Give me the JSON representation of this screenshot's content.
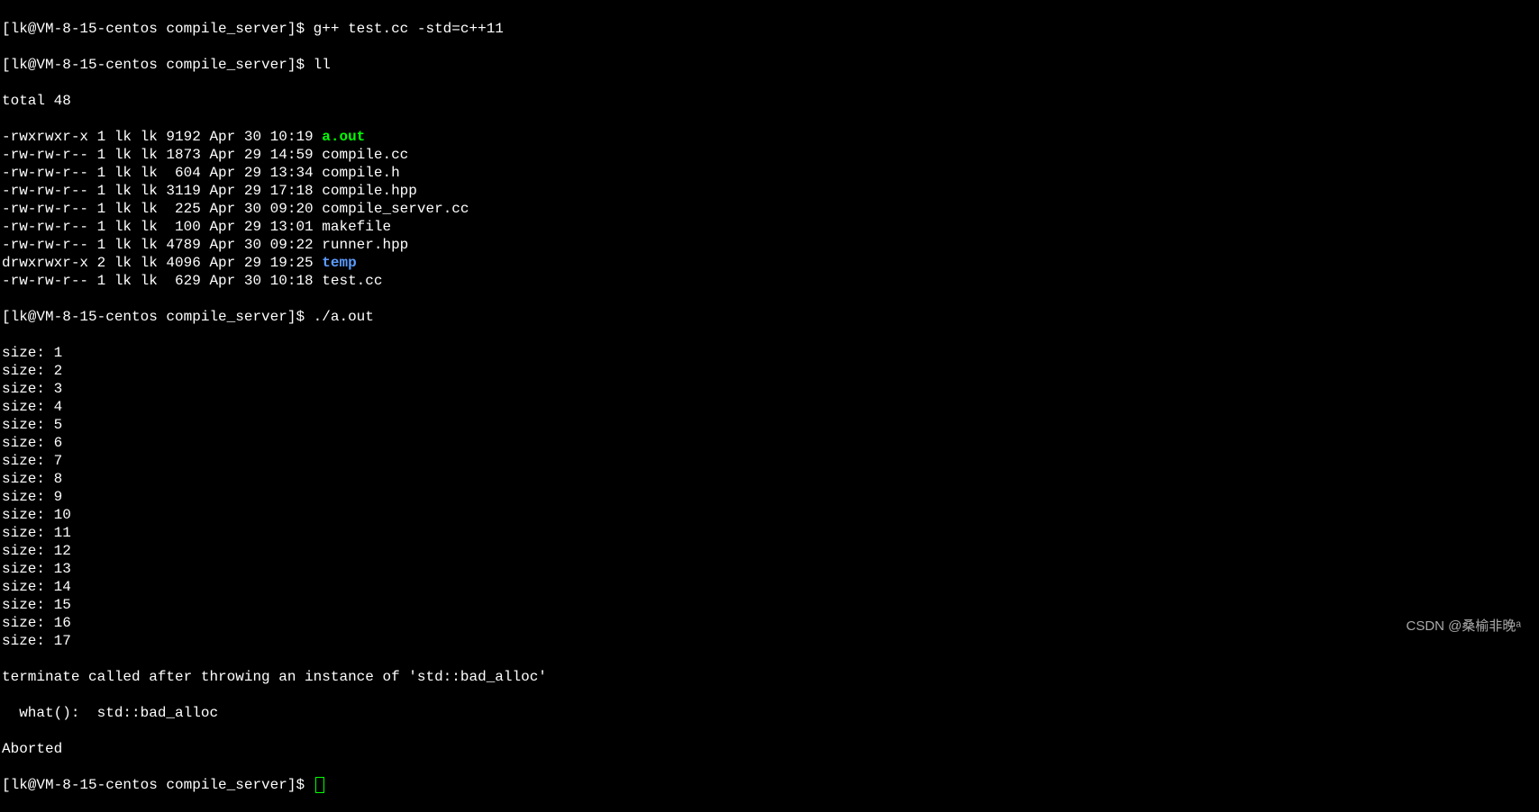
{
  "prompt": "[lk@VM-8-15-centos compile_server]$ ",
  "commands": {
    "compile": "g++ test.cc -std=c++11",
    "list": "ll",
    "run": "./a.out"
  },
  "listing": {
    "total": "total 48",
    "files": [
      {
        "perm": "-rwxrwxr-x",
        "links": "1",
        "owner": "lk",
        "group": "lk",
        "size": "9192",
        "date": "Apr 30 10:19",
        "name": "a.out",
        "type": "exec"
      },
      {
        "perm": "-rw-rw-r--",
        "links": "1",
        "owner": "lk",
        "group": "lk",
        "size": "1873",
        "date": "Apr 29 14:59",
        "name": "compile.cc",
        "type": "file"
      },
      {
        "perm": "-rw-rw-r--",
        "links": "1",
        "owner": "lk",
        "group": "lk",
        "size": " 604",
        "date": "Apr 29 13:34",
        "name": "compile.h",
        "type": "file"
      },
      {
        "perm": "-rw-rw-r--",
        "links": "1",
        "owner": "lk",
        "group": "lk",
        "size": "3119",
        "date": "Apr 29 17:18",
        "name": "compile.hpp",
        "type": "file"
      },
      {
        "perm": "-rw-rw-r--",
        "links": "1",
        "owner": "lk",
        "group": "lk",
        "size": " 225",
        "date": "Apr 30 09:20",
        "name": "compile_server.cc",
        "type": "file"
      },
      {
        "perm": "-rw-rw-r--",
        "links": "1",
        "owner": "lk",
        "group": "lk",
        "size": " 100",
        "date": "Apr 29 13:01",
        "name": "makefile",
        "type": "file"
      },
      {
        "perm": "-rw-rw-r--",
        "links": "1",
        "owner": "lk",
        "group": "lk",
        "size": "4789",
        "date": "Apr 30 09:22",
        "name": "runner.hpp",
        "type": "file"
      },
      {
        "perm": "drwxrwxr-x",
        "links": "2",
        "owner": "lk",
        "group": "lk",
        "size": "4096",
        "date": "Apr 29 19:25",
        "name": "temp",
        "type": "dir"
      },
      {
        "perm": "-rw-rw-r--",
        "links": "1",
        "owner": "lk",
        "group": "lk",
        "size": " 629",
        "date": "Apr 30 10:18",
        "name": "test.cc",
        "type": "file"
      }
    ]
  },
  "output": {
    "sizes": [
      "size: 1",
      "size: 2",
      "size: 3",
      "size: 4",
      "size: 5",
      "size: 6",
      "size: 7",
      "size: 8",
      "size: 9",
      "size: 10",
      "size: 11",
      "size: 12",
      "size: 13",
      "size: 14",
      "size: 15",
      "size: 16",
      "size: 17"
    ],
    "error1": "terminate called after throwing an instance of 'std::bad_alloc'",
    "error2": "  what():  std::bad_alloc",
    "aborted": "Aborted"
  },
  "watermark": "CSDN @桑榆非晚ᵃ"
}
